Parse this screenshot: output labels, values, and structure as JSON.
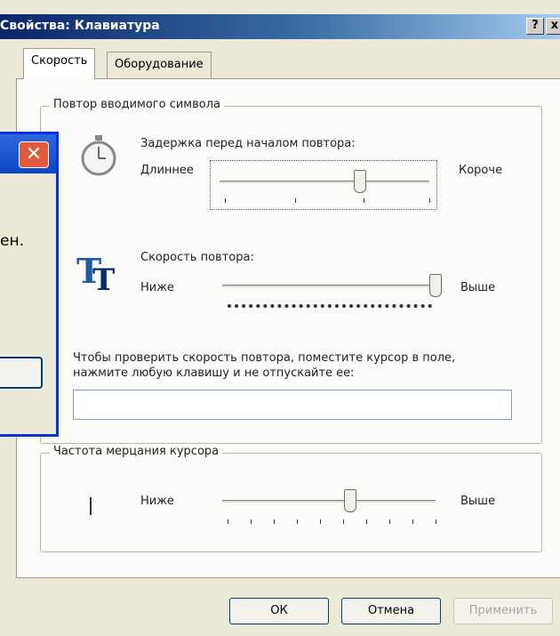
{
  "window": {
    "title": "Свойства: Клавиатура",
    "help_label": "?",
    "close_label": "x"
  },
  "tabs": [
    {
      "label": "Скорость",
      "active": true
    },
    {
      "label": "Оборудование",
      "active": false
    }
  ],
  "repeat_group": {
    "legend": "Повтор вводимого символа",
    "delay": {
      "label": "Задержка перед началом повтора:",
      "left_label": "Длиннее",
      "right_label": "Короче",
      "level": 0.67,
      "icon": "stopwatch-icon"
    },
    "rate": {
      "label": "Скорость повтора:",
      "left_label": "Ниже",
      "right_label": "Выше",
      "level": 1.0,
      "icon": "letters-tt-icon"
    },
    "test_instruction": "Чтобы проверить скорость повтора, поместите курсор в поле, нажмите любую клавишу и не отпускайте ее:",
    "test_value": ""
  },
  "blink_group": {
    "legend": "Частота мерцания курсора",
    "left_label": "Ниже",
    "right_label": "Выше",
    "level": 0.6,
    "icon": "text-cursor-icon"
  },
  "buttons": {
    "ok": "ОК",
    "cancel": "Отмена",
    "apply": "Применить"
  },
  "overlay": {
    "text_fragment": "ен.",
    "close_label": "✕"
  }
}
